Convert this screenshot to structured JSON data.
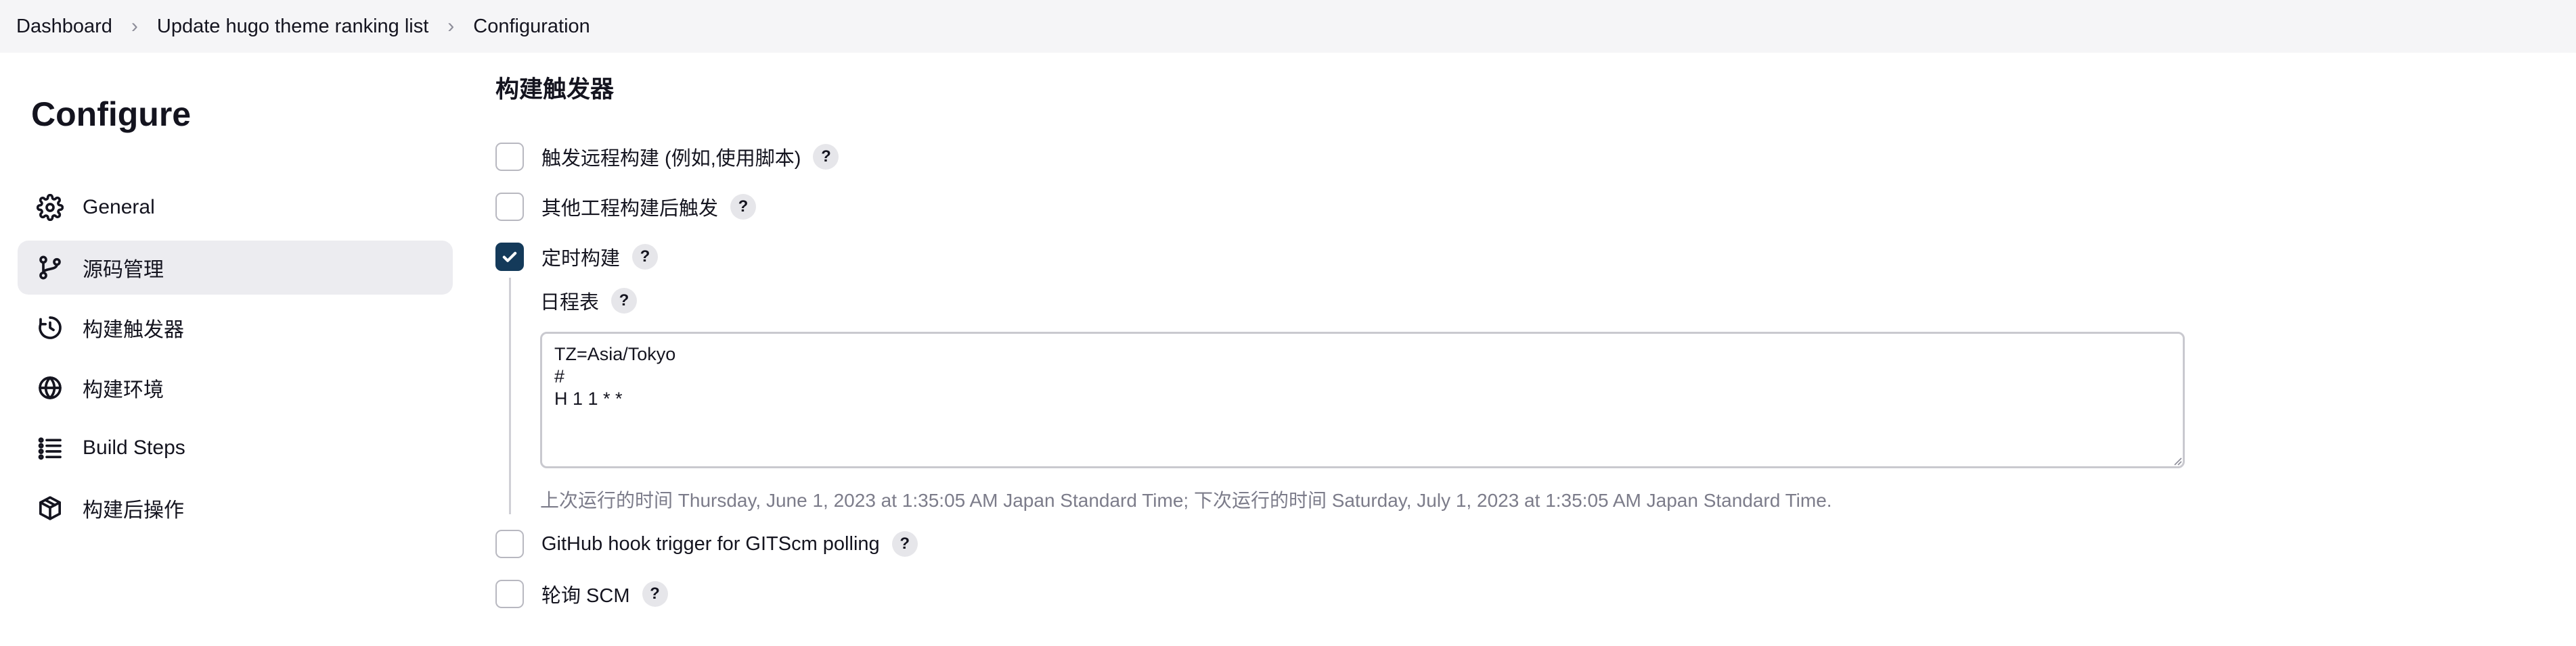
{
  "breadcrumb": {
    "items": [
      "Dashboard",
      "Update hugo theme ranking list",
      "Configuration"
    ]
  },
  "sidebar": {
    "title": "Configure",
    "items": [
      {
        "label": "General",
        "icon": "gear-icon"
      },
      {
        "label": "源码管理",
        "icon": "branch-icon",
        "active": true
      },
      {
        "label": "构建触发器",
        "icon": "clock-icon"
      },
      {
        "label": "构建环境",
        "icon": "globe-icon"
      },
      {
        "label": "Build Steps",
        "icon": "list-icon"
      },
      {
        "label": "构建后操作",
        "icon": "package-icon"
      }
    ]
  },
  "main": {
    "section_title": "构建触发器",
    "help_symbol": "?",
    "options": [
      {
        "label": "触发远程构建 (例如,使用脚本)",
        "checked": false
      },
      {
        "label": "其他工程构建后触发",
        "checked": false
      },
      {
        "label": "定时构建",
        "checked": true
      },
      {
        "label": "GitHub hook trigger for GITScm polling",
        "checked": false
      },
      {
        "label": "轮询 SCM",
        "checked": false
      }
    ],
    "schedule": {
      "label": "日程表",
      "value": "TZ=Asia/Tokyo\n#\nH 1 1 * *",
      "hint": "上次运行的时间 Thursday, June 1, 2023 at 1:35:05 AM Japan Standard Time; 下次运行的时间 Saturday, July 1, 2023 at 1:35:05 AM Japan Standard Time."
    }
  },
  "colors": {
    "checkbox_checked": "#143a5a",
    "active_nav_bg": "#ececf0",
    "breadcrumb_bg": "#f5f5f7"
  }
}
